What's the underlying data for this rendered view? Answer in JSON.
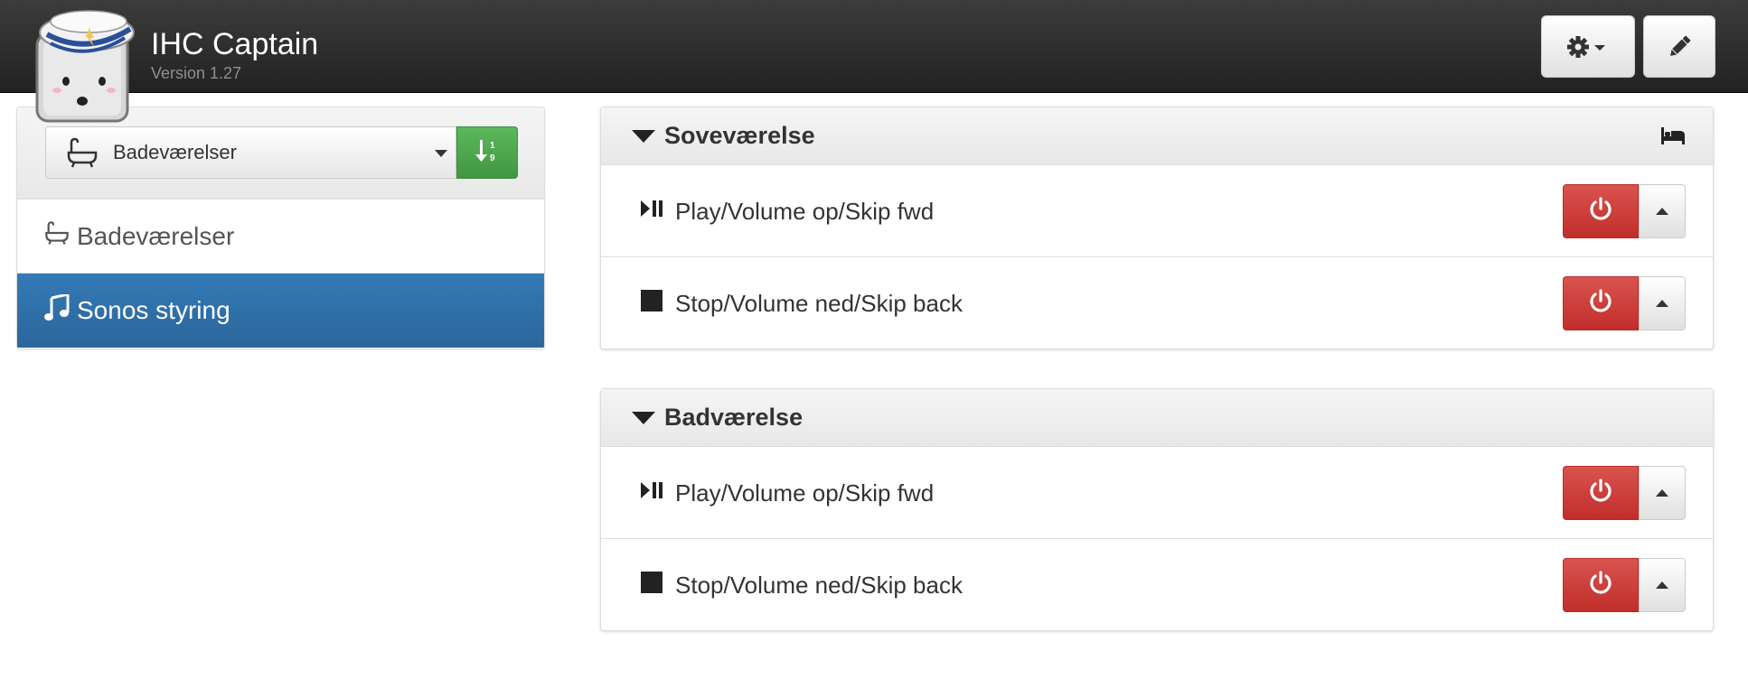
{
  "app": {
    "title": "IHC Captain",
    "version": "Version 1.27",
    "logo_icon": "sailor-plug-logo",
    "settings_icon": "gear-caret-icon",
    "edit_icon": "pencil-icon"
  },
  "sidebar": {
    "selected_room": "Badeværelser",
    "sort_button_icon": "sort-icon",
    "items": [
      {
        "label": "Badeværelser",
        "icon": "bathtub-icon",
        "active": false
      },
      {
        "label": "Sonos styring",
        "icon": "music-icon",
        "active": true
      }
    ]
  },
  "sections": [
    {
      "title": "Soveværelse",
      "icon": "bed-icon",
      "rows": [
        {
          "label": "Play/Volume op/Skip fwd",
          "icon": "play-pause-icon"
        },
        {
          "label": "Stop/Volume ned/Skip back",
          "icon": "stop-icon"
        }
      ]
    },
    {
      "title": "Badværelse",
      "rows": [
        {
          "label": "Play/Volume op/Skip fwd",
          "icon": "play-pause-icon"
        },
        {
          "label": "Stop/Volume ned/Skip back",
          "icon": "stop-icon"
        }
      ]
    }
  ],
  "colors": {
    "navbar": "#222222",
    "active_nav": "#337ab7",
    "danger": "#d9534f",
    "success": "#5cb85c"
  }
}
